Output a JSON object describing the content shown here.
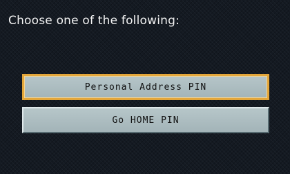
{
  "screen": {
    "prompt": "Choose one of the following:"
  },
  "menu": {
    "options": [
      {
        "label": "Personal Address PIN",
        "selected": true
      },
      {
        "label": "Go HOME PIN",
        "selected": false
      }
    ]
  },
  "colors": {
    "background": "#141a22",
    "button_face": "#aebec2",
    "selection_highlight": "#e3a63a",
    "prompt_text": "#f2f2f2"
  }
}
